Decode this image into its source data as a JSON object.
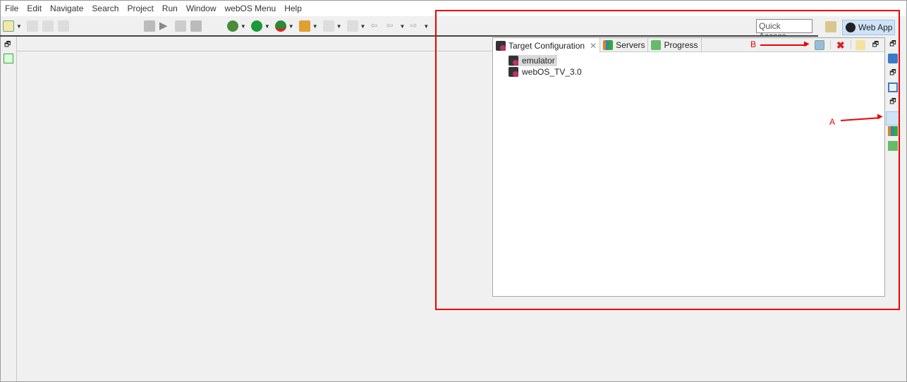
{
  "menu": [
    "File",
    "Edit",
    "Navigate",
    "Search",
    "Project",
    "Run",
    "Window",
    "webOS Menu",
    "Help"
  ],
  "toolbar": {
    "quick_access": "Quick Access",
    "perspective": "Web App"
  },
  "view": {
    "tabs": [
      {
        "label": "Target Configuration",
        "active": true
      },
      {
        "label": "Servers"
      },
      {
        "label": "Progress"
      }
    ],
    "targets": [
      {
        "label": "emulator",
        "selected": true
      },
      {
        "label": "webOS_TV_3.0"
      }
    ]
  },
  "annotations": {
    "a": "A",
    "b": "B"
  },
  "colors": {
    "annotation": "#e00000",
    "selection": "#cfe3f7"
  }
}
